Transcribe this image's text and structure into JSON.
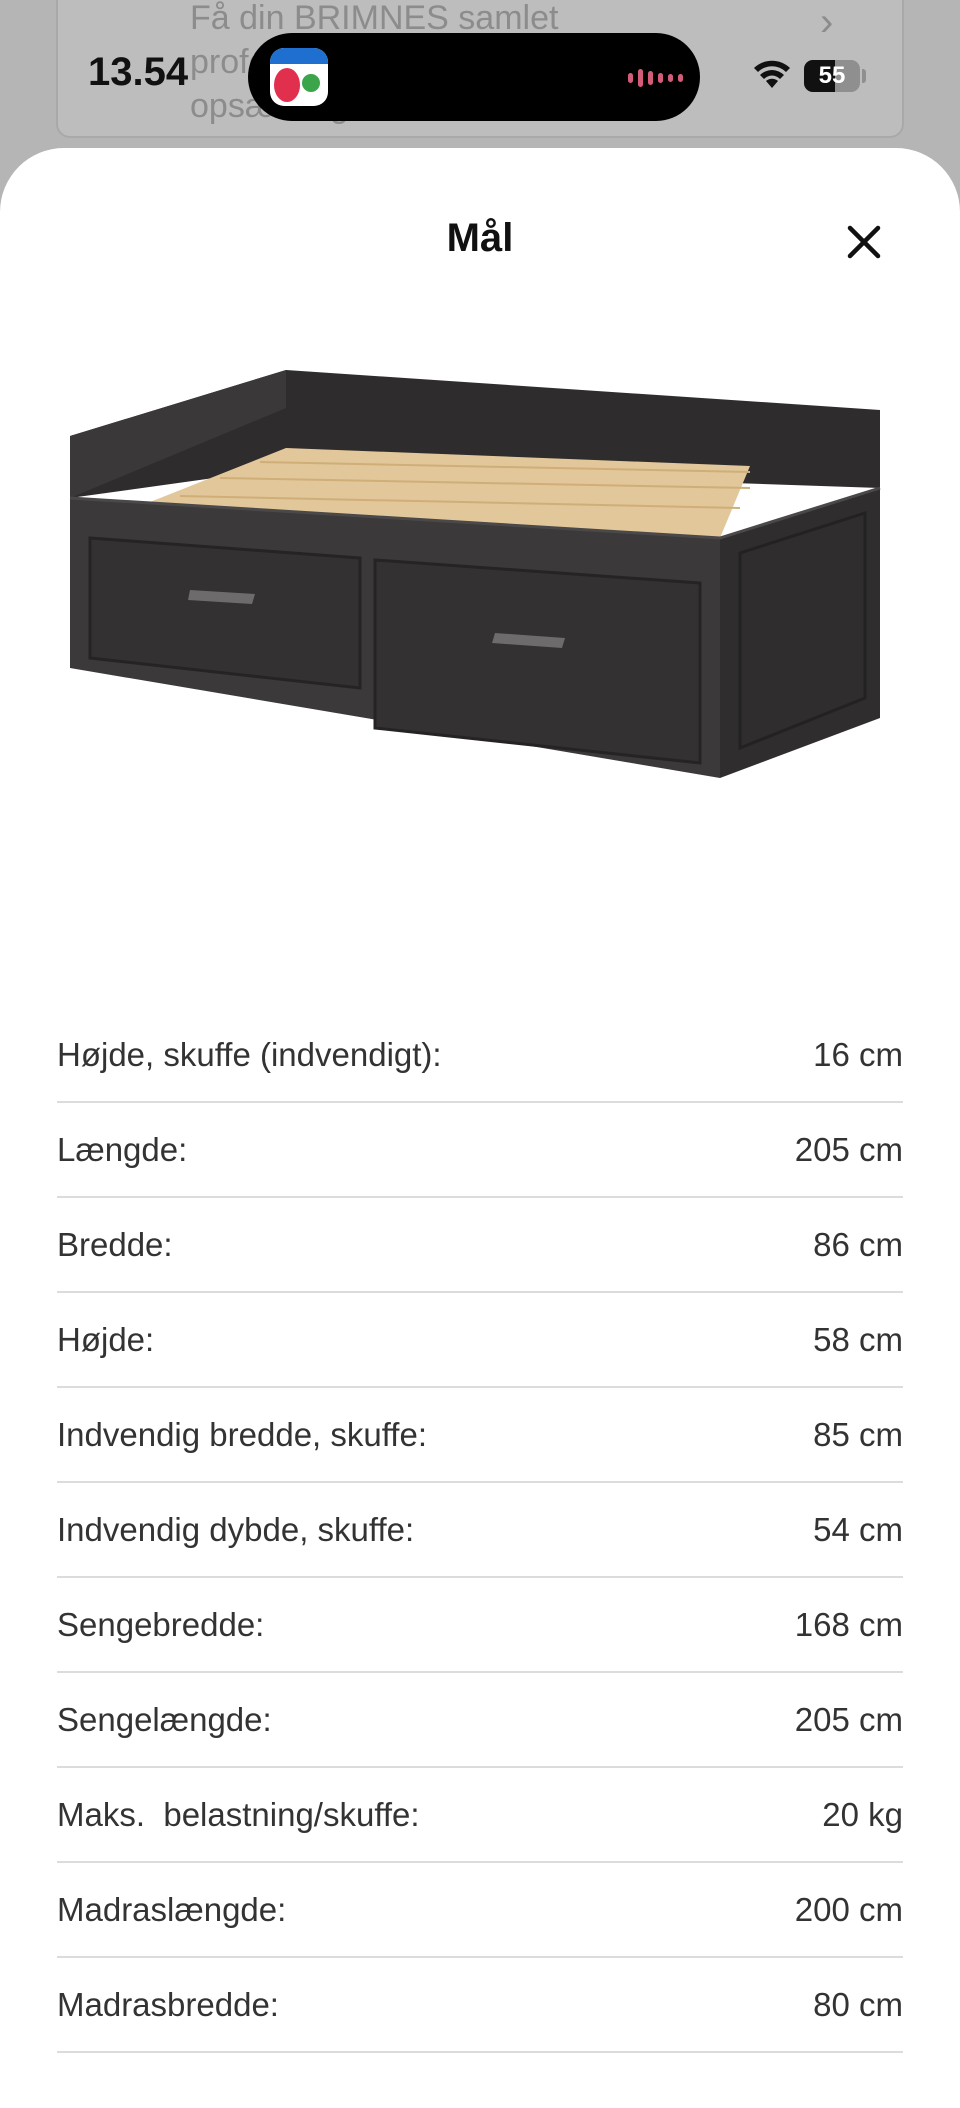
{
  "background": {
    "card_text": "Få din BRIMNES samlet\nprofessionelt fra 970\nopsætning"
  },
  "status_bar": {
    "time": "13.54",
    "battery": "55",
    "battery_level": 0.55
  },
  "sheet": {
    "title": "Mål",
    "close_icon": "close-icon",
    "image": "daybed-with-drawers"
  },
  "dimensions": [
    {
      "label": "Højde, skuffe (indvendigt):",
      "value": "16 cm"
    },
    {
      "label": "Længde:",
      "value": "205 cm"
    },
    {
      "label": "Bredde:",
      "value": "86 cm"
    },
    {
      "label": "Højde:",
      "value": "58 cm"
    },
    {
      "label": "Indvendig bredde, skuffe:",
      "value": "85 cm"
    },
    {
      "label": "Indvendig dybde, skuffe:",
      "value": "54 cm"
    },
    {
      "label": "Sengebredde:",
      "value": "168 cm"
    },
    {
      "label": "Sengelængde:",
      "value": "205 cm"
    },
    {
      "label": "Maks.  belastning/skuffe:",
      "value": "20 kg"
    },
    {
      "label": "Madraslængde:",
      "value": "200 cm"
    },
    {
      "label": "Madrasbredde:",
      "value": "80 cm"
    }
  ]
}
